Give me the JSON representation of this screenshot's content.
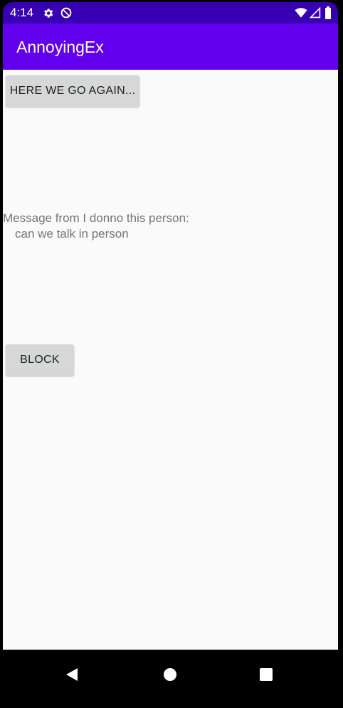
{
  "status_bar": {
    "time": "4:14",
    "icons": [
      "settings-icon",
      "data-saver-icon",
      "wifi-icon",
      "signal-icon",
      "battery-icon"
    ]
  },
  "app_bar": {
    "title": "AnnoyingEx"
  },
  "main": {
    "again_button_label": "HERE WE GO AGAIN...",
    "message_header": "Message from I donno this person:",
    "message_body": "can we talk in person",
    "block_button_label": "BLOCK"
  },
  "nav_bar": {
    "icons": [
      "back-icon",
      "home-icon",
      "recents-icon"
    ]
  },
  "colors": {
    "status_bar": "#3700B3",
    "app_bar": "#6200EE",
    "background": "#FAFAFA",
    "button": "#D6D7D7",
    "message_text": "#757575"
  }
}
